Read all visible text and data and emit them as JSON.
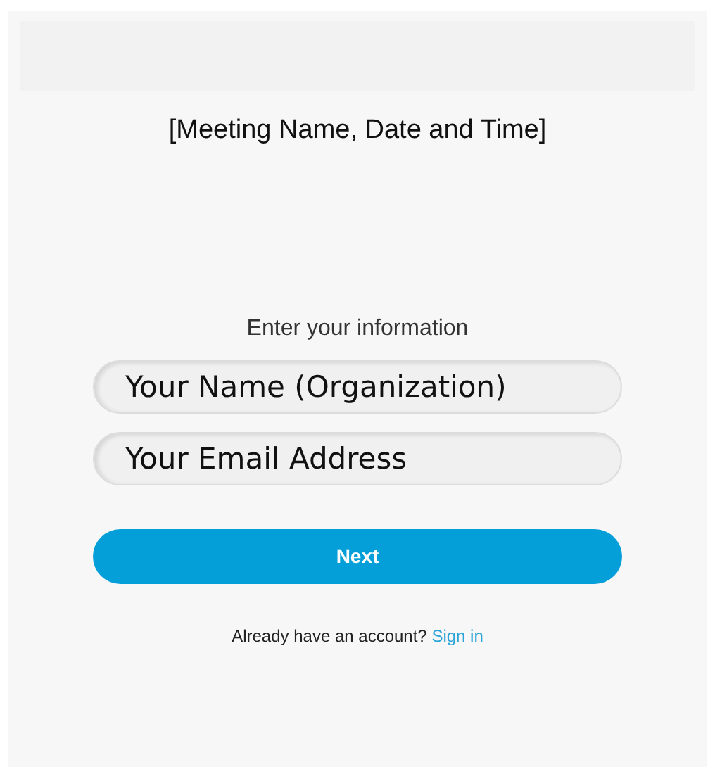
{
  "meeting_title": "[Meeting Name, Date and Time]",
  "form": {
    "heading": "Enter your information",
    "fields": [
      {
        "placeholder": "Your Name (Organization)"
      },
      {
        "placeholder": "Your Email Address"
      }
    ],
    "next_button": "Next"
  },
  "footer": {
    "prompt": "Already have an account?",
    "link": "Sign in"
  }
}
